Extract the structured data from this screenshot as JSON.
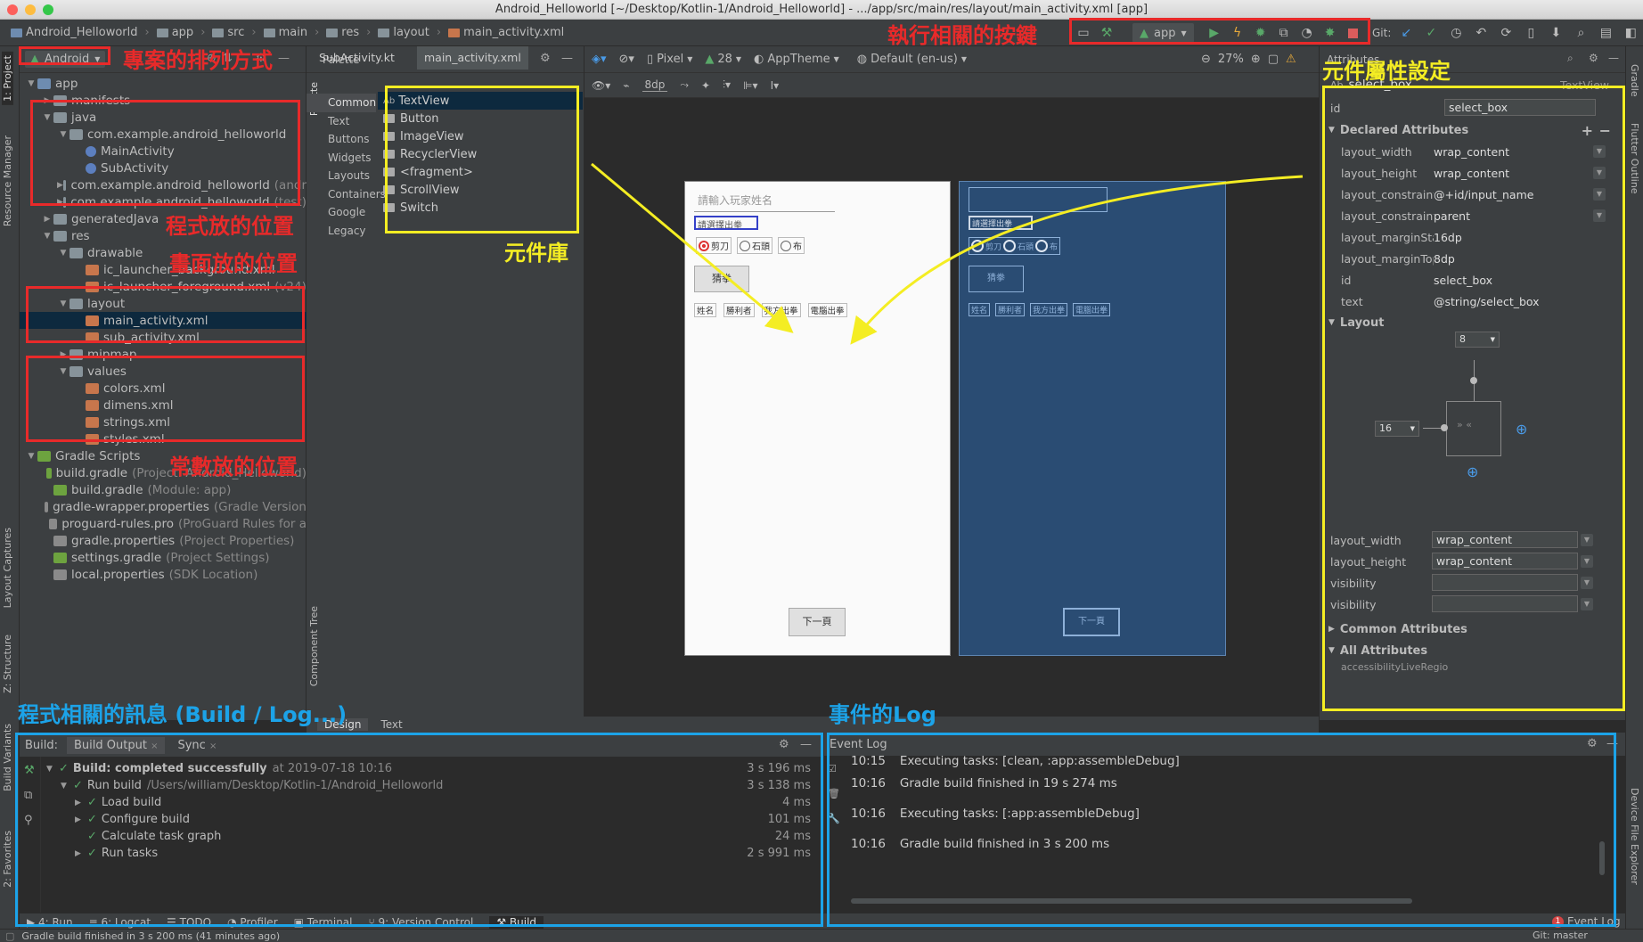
{
  "window": {
    "title": "Android_Helloworld [~/Desktop/Kotlin-1/Android_Helloworld] - .../app/src/main/res/layout/main_activity.xml [app]"
  },
  "breadcrumbs": [
    "Android_Helloworld",
    "app",
    "src",
    "main",
    "res",
    "layout",
    "main_activity.xml"
  ],
  "toolbar": {
    "run_config": "app",
    "git_label": "Git:"
  },
  "project_panel": {
    "view_mode": "Android",
    "tree": [
      {
        "label": "app",
        "extra": "",
        "depth": 0,
        "icon": "folder"
      },
      {
        "label": "manifests",
        "extra": "",
        "depth": 1,
        "icon": "folder"
      },
      {
        "label": "java",
        "extra": "",
        "depth": 1,
        "icon": "folder"
      },
      {
        "label": "com.example.android_helloworld",
        "extra": "",
        "depth": 2,
        "icon": "folder"
      },
      {
        "label": "MainActivity",
        "extra": "",
        "depth": 3,
        "icon": "kt"
      },
      {
        "label": "SubActivity",
        "extra": "",
        "depth": 3,
        "icon": "kt"
      },
      {
        "label": "com.example.android_helloworld",
        "extra": "(andr",
        "depth": 2,
        "icon": "folder"
      },
      {
        "label": "com.example.android_helloworld",
        "extra": "(test)",
        "depth": 2,
        "icon": "folder"
      },
      {
        "label": "generatedJava",
        "extra": "",
        "depth": 1,
        "icon": "folder"
      },
      {
        "label": "res",
        "extra": "",
        "depth": 1,
        "icon": "folder"
      },
      {
        "label": "drawable",
        "extra": "",
        "depth": 2,
        "icon": "folder"
      },
      {
        "label": "ic_launcher_background.xml",
        "extra": "",
        "depth": 3,
        "icon": "xml"
      },
      {
        "label": "ic_launcher_foreground.xml",
        "extra": "(v24)",
        "depth": 3,
        "icon": "xml"
      },
      {
        "label": "layout",
        "extra": "",
        "depth": 2,
        "icon": "folder"
      },
      {
        "label": "main_activity.xml",
        "extra": "",
        "depth": 3,
        "icon": "xml"
      },
      {
        "label": "sub_activity.xml",
        "extra": "",
        "depth": 3,
        "icon": "xml"
      },
      {
        "label": "mipmap",
        "extra": "",
        "depth": 2,
        "icon": "folder"
      },
      {
        "label": "values",
        "extra": "",
        "depth": 2,
        "icon": "folder"
      },
      {
        "label": "colors.xml",
        "extra": "",
        "depth": 3,
        "icon": "xml"
      },
      {
        "label": "dimens.xml",
        "extra": "",
        "depth": 3,
        "icon": "xml"
      },
      {
        "label": "strings.xml",
        "extra": "",
        "depth": 3,
        "icon": "xml"
      },
      {
        "label": "styles.xml",
        "extra": "",
        "depth": 3,
        "icon": "xml"
      },
      {
        "label": "Gradle Scripts",
        "extra": "",
        "depth": 0,
        "icon": "gradle"
      },
      {
        "label": "build.gradle",
        "extra": "(Project: Android_Helloworld)",
        "depth": 1,
        "icon": "gradle"
      },
      {
        "label": "build.gradle",
        "extra": "(Module: app)",
        "depth": 1,
        "icon": "gradle"
      },
      {
        "label": "gradle-wrapper.properties",
        "extra": "(Gradle Version",
        "depth": 1,
        "icon": "file"
      },
      {
        "label": "proguard-rules.pro",
        "extra": "(ProGuard Rules for a",
        "depth": 1,
        "icon": "file"
      },
      {
        "label": "gradle.properties",
        "extra": "(Project Properties)",
        "depth": 1,
        "icon": "file"
      },
      {
        "label": "settings.gradle",
        "extra": "(Project Settings)",
        "depth": 1,
        "icon": "gradle"
      },
      {
        "label": "local.properties",
        "extra": "(SDK Location)",
        "depth": 1,
        "icon": "file"
      }
    ]
  },
  "editor_tabs": [
    "SubActivity.kt",
    "main_activity.xml"
  ],
  "palette": {
    "title": "Palette",
    "categories": [
      "Common",
      "Text",
      "Buttons",
      "Widgets",
      "Layouts",
      "Containers",
      "Google",
      "Legacy"
    ],
    "items": [
      "TextView",
      "Button",
      "ImageView",
      "RecyclerView",
      "<fragment>",
      "ScrollView",
      "Switch"
    ],
    "textview_prefix": "Ab"
  },
  "design_toolbar": {
    "device": "Pixel",
    "api": "28",
    "theme": "AppTheme",
    "locale": "Default (en-us)",
    "zoom": "27%",
    "margin": "8dp"
  },
  "phone_preview": {
    "name_hint": "請輸入玩家姓名",
    "select_box": "請選擇出拳",
    "radios": [
      "剪刀",
      "石頭",
      "布"
    ],
    "play_button": "猜拳",
    "result_labels": [
      "姓名",
      "勝利者",
      "我方出拳",
      "電腦出拳"
    ],
    "next_button": "下一頁"
  },
  "attributes": {
    "header": "Attributes",
    "component": "select_box",
    "component_type": "TextView",
    "id_label": "id",
    "id_value": "select_box",
    "declared_title": "Declared Attributes",
    "declared": [
      {
        "k": "layout_width",
        "v": "wrap_content"
      },
      {
        "k": "layout_height",
        "v": "wrap_content"
      },
      {
        "k": "layout_constraintTop_",
        "v": "@+id/input_name"
      },
      {
        "k": "layout_constraintStart",
        "v": "parent"
      },
      {
        "k": "layout_marginStart",
        "v": "16dp"
      },
      {
        "k": "layout_marginTop",
        "v": "8dp"
      },
      {
        "k": "id",
        "v": "select_box"
      },
      {
        "k": "text",
        "v": "@string/select_box"
      }
    ],
    "layout_title": "Layout",
    "constraint_top": "8",
    "constraint_start": "16",
    "layout_props": [
      {
        "k": "layout_width",
        "v": "wrap_content"
      },
      {
        "k": "layout_height",
        "v": "wrap_content"
      },
      {
        "k": "visibility",
        "v": ""
      },
      {
        "k": "visibility",
        "v": ""
      }
    ],
    "common_title": "Common Attributes",
    "all_title": "All Attributes",
    "cut_text": "accessibilityLiveRegio"
  },
  "design_tabs": [
    "Design",
    "Text"
  ],
  "build_panel": {
    "label": "Build:",
    "tabs": [
      "Build Output",
      "Sync"
    ],
    "rows": [
      {
        "text": "Build: completed successfully",
        "extra": "at 2019-07-18 10:16",
        "time": "3 s 196 ms",
        "depth": 0
      },
      {
        "text": "Run build",
        "extra": "/Users/william/Desktop/Kotlin-1/Android_Helloworld",
        "time": "3 s 138 ms",
        "depth": 1
      },
      {
        "text": "Load build",
        "extra": "",
        "time": "4 ms",
        "depth": 2
      },
      {
        "text": "Configure build",
        "extra": "",
        "time": "101 ms",
        "depth": 2
      },
      {
        "text": "Calculate task graph",
        "extra": "",
        "time": "24 ms",
        "depth": 2
      },
      {
        "text": "Run tasks",
        "extra": "",
        "time": "2 s 991 ms",
        "depth": 2
      }
    ]
  },
  "event_log": {
    "title": "Event Log",
    "entries": [
      {
        "time": "10:15",
        "msg": "Executing tasks: [clean, :app:assembleDebug]"
      },
      {
        "time": "10:16",
        "msg": "Gradle build finished in 19 s 274 ms"
      },
      {
        "time": "10:16",
        "msg": "Executing tasks: [:app:assembleDebug]"
      },
      {
        "time": "10:16",
        "msg": "Gradle build finished in 3 s 200 ms"
      }
    ],
    "badge_count": "1",
    "badge_label": "Event Log"
  },
  "bottom_tabs": [
    "4: Run",
    "6: Logcat",
    "TODO",
    "Profiler",
    "Terminal",
    "9: Version Control",
    "Build"
  ],
  "status_bar": {
    "message": "Gradle build finished in 3 s 200 ms (41 minutes ago)",
    "git": "Git: master"
  },
  "left_stripe": [
    "1: Project",
    "Resource Manager",
    "Layout Captures",
    "Z: Structure",
    "Build Variants",
    "2: Favorites"
  ],
  "right_stripe": [
    "Gradle",
    "Flutter Outline",
    "Device File Explorer"
  ],
  "annotations": {
    "project_mode": "專案的排列方式",
    "code_location": "程式放的位置",
    "layout_location": "畫面放的位置",
    "values_location": "常數放的位置",
    "run_buttons": "執行相關的按鍵",
    "components": "元件庫",
    "properties": "元件屬性設定",
    "build_info": "程式相關的訊息 (Build / Log...)",
    "event_log": "事件的Log"
  },
  "colors": {
    "annotation_red": "#e82a2a",
    "annotation_yellow": "#f4ed23",
    "annotation_cyan": "#1ca3e8",
    "ide_bg": "#3c3f41"
  }
}
